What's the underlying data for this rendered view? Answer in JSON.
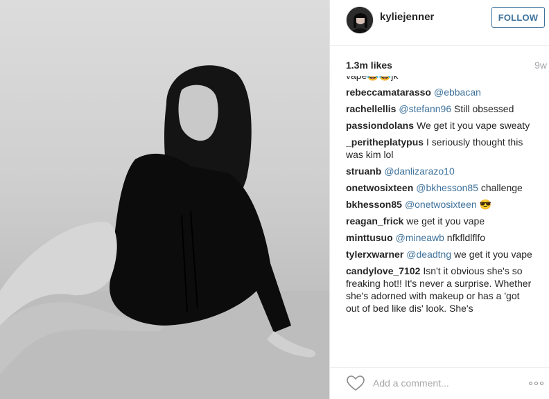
{
  "post": {
    "username": "kyliejenner",
    "follow_label": "FOLLOW",
    "likes": "1.3m likes",
    "age": "9w",
    "photo_alt": "kyliejenner photo",
    "comment_placeholder": "Add a comment...",
    "colors": {
      "link": "#3f729b",
      "text": "#262626",
      "muted": "#a5a7aa"
    }
  },
  "comments": [
    {
      "user": "",
      "text": "vape😂😂jk",
      "mention": ""
    },
    {
      "user": "rebeccamatarasso",
      "text": "",
      "mention": "@ebbacan"
    },
    {
      "user": "rachellellis",
      "text": "Still obsessed",
      "mention": "@stefann96"
    },
    {
      "user": "passiondolans",
      "text": "We get it you vape sweaty",
      "mention": ""
    },
    {
      "user": "_peritheplatypus",
      "text": "I seriously thought this was kim lol",
      "mention": ""
    },
    {
      "user": "struanb",
      "text": "",
      "mention": "@danlizarazo10"
    },
    {
      "user": "onetwosixteen",
      "text": "challenge",
      "mention": "@bkhesson85"
    },
    {
      "user": "bkhesson85",
      "text": "😎",
      "mention": "@onetwosixteen"
    },
    {
      "user": "reagan_frick",
      "text": "we get it you vape",
      "mention": ""
    },
    {
      "user": "minttusuo",
      "text": "nfkfldlflfo",
      "mention": "@mineawb"
    },
    {
      "user": "tylerxwarner",
      "text": "we get it you vape",
      "mention": "@deadtng"
    },
    {
      "user": "candylove_7102",
      "text": "Isn't it obvious she's so freaking hot!! It's never a surprise. Whether she's adorned with makeup or has a 'got out of bed like dis' look. She's",
      "mention": ""
    }
  ]
}
